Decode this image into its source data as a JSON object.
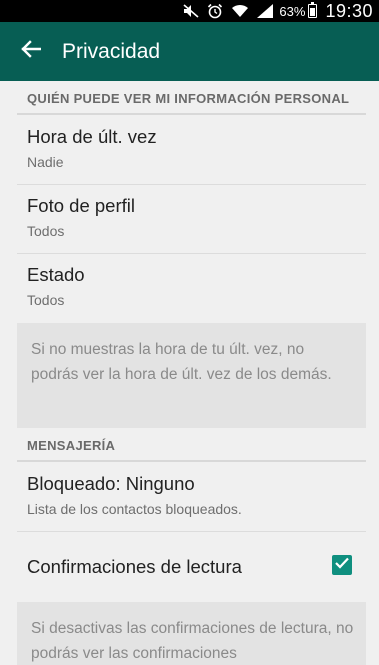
{
  "status_bar": {
    "battery_percent": "63%",
    "battery_level": 0.63,
    "time": "19:30",
    "icons": [
      "mute-icon",
      "alarm-icon",
      "wifi-icon",
      "signal-icon",
      "battery-icon"
    ]
  },
  "app_bar": {
    "title": "Privacidad",
    "back_icon": "arrow-back-icon",
    "color": "#075e54"
  },
  "sections": {
    "personal_info_header": "QUIÉN PUEDE VER MI INFORMACIÓN PERSONAL",
    "last_seen": {
      "title": "Hora de últ. vez",
      "value": "Nadie"
    },
    "profile_photo": {
      "title": "Foto de perfil",
      "value": "Todos"
    },
    "status": {
      "title": "Estado",
      "value": "Todos"
    },
    "last_seen_note": "Si no muestras la hora de tu últ. vez, no podrás ver la hora de últ. vez de los demás.",
    "messaging_header": "MENSAJERÍA",
    "blocked": {
      "title": "Bloqueado: Ninguno",
      "subtitle": "Lista de los contactos bloqueados."
    },
    "read_receipts": {
      "title": "Confirmaciones de lectura",
      "checked": true,
      "checkbox_color": "#0f8f7f"
    },
    "read_receipts_note": "Si desactivas las confirmaciones de lectura, no podrás ver las confirmaciones"
  }
}
